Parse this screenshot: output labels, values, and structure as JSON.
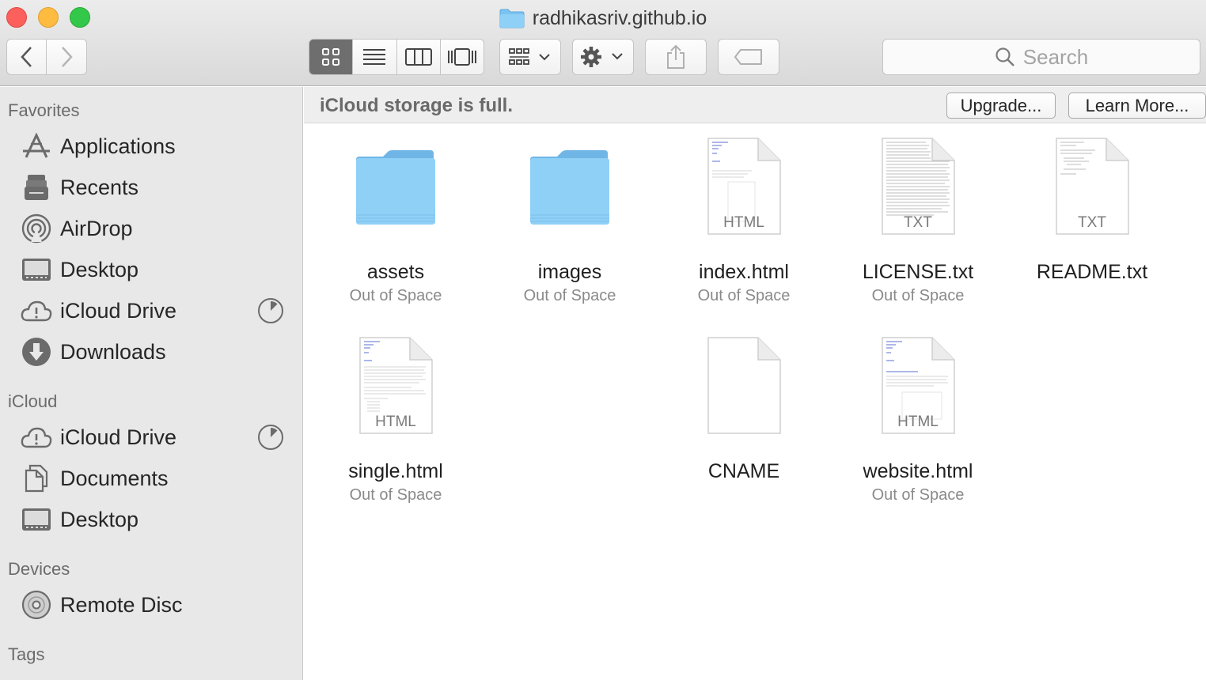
{
  "window": {
    "title": "radhikasriv.github.io"
  },
  "toolbar": {
    "search_placeholder": "Search"
  },
  "banner": {
    "message": "iCloud storage is full.",
    "upgrade_label": "Upgrade...",
    "learn_more_label": "Learn More..."
  },
  "sidebar": {
    "favorites_header": "Favorites",
    "favorites": [
      {
        "label": "Applications",
        "icon": "applications-icon"
      },
      {
        "label": "Recents",
        "icon": "recents-icon"
      },
      {
        "label": "AirDrop",
        "icon": "airdrop-icon"
      },
      {
        "label": "Desktop",
        "icon": "desktop-icon"
      },
      {
        "label": "iCloud Drive",
        "icon": "icloud-warning-icon"
      },
      {
        "label": "Downloads",
        "icon": "downloads-icon"
      }
    ],
    "icloud_header": "iCloud",
    "icloud": [
      {
        "label": "iCloud Drive",
        "icon": "icloud-warning-icon"
      },
      {
        "label": "Documents",
        "icon": "documents-icon"
      },
      {
        "label": "Desktop",
        "icon": "desktop-icon"
      }
    ],
    "devices_header": "Devices",
    "devices": [
      {
        "label": "Remote Disc",
        "icon": "disc-icon"
      }
    ],
    "tags_header": "Tags"
  },
  "files": [
    {
      "name": "assets",
      "status": "Out of Space",
      "kind": "folder"
    },
    {
      "name": "images",
      "status": "Out of Space",
      "kind": "folder"
    },
    {
      "name": "index.html",
      "status": "Out of Space",
      "kind": "document",
      "ext": "HTML"
    },
    {
      "name": "LICENSE.txt",
      "status": "Out of Space",
      "kind": "document",
      "ext": "TXT"
    },
    {
      "name": "README.txt",
      "status": "",
      "kind": "document",
      "ext": "TXT"
    },
    {
      "name": "single.html",
      "status": "Out of Space",
      "kind": "document",
      "ext": "HTML"
    },
    {
      "name": "CNAME",
      "status": "",
      "kind": "document",
      "ext": ""
    },
    {
      "name": "website.html",
      "status": "Out of Space",
      "kind": "document",
      "ext": "HTML"
    }
  ],
  "colors": {
    "folder": "#7cc3f0",
    "sidebar_bg": "#e8e8e8",
    "close": "#fc605c",
    "minimize": "#fdbc40",
    "maximize": "#34c84a"
  }
}
